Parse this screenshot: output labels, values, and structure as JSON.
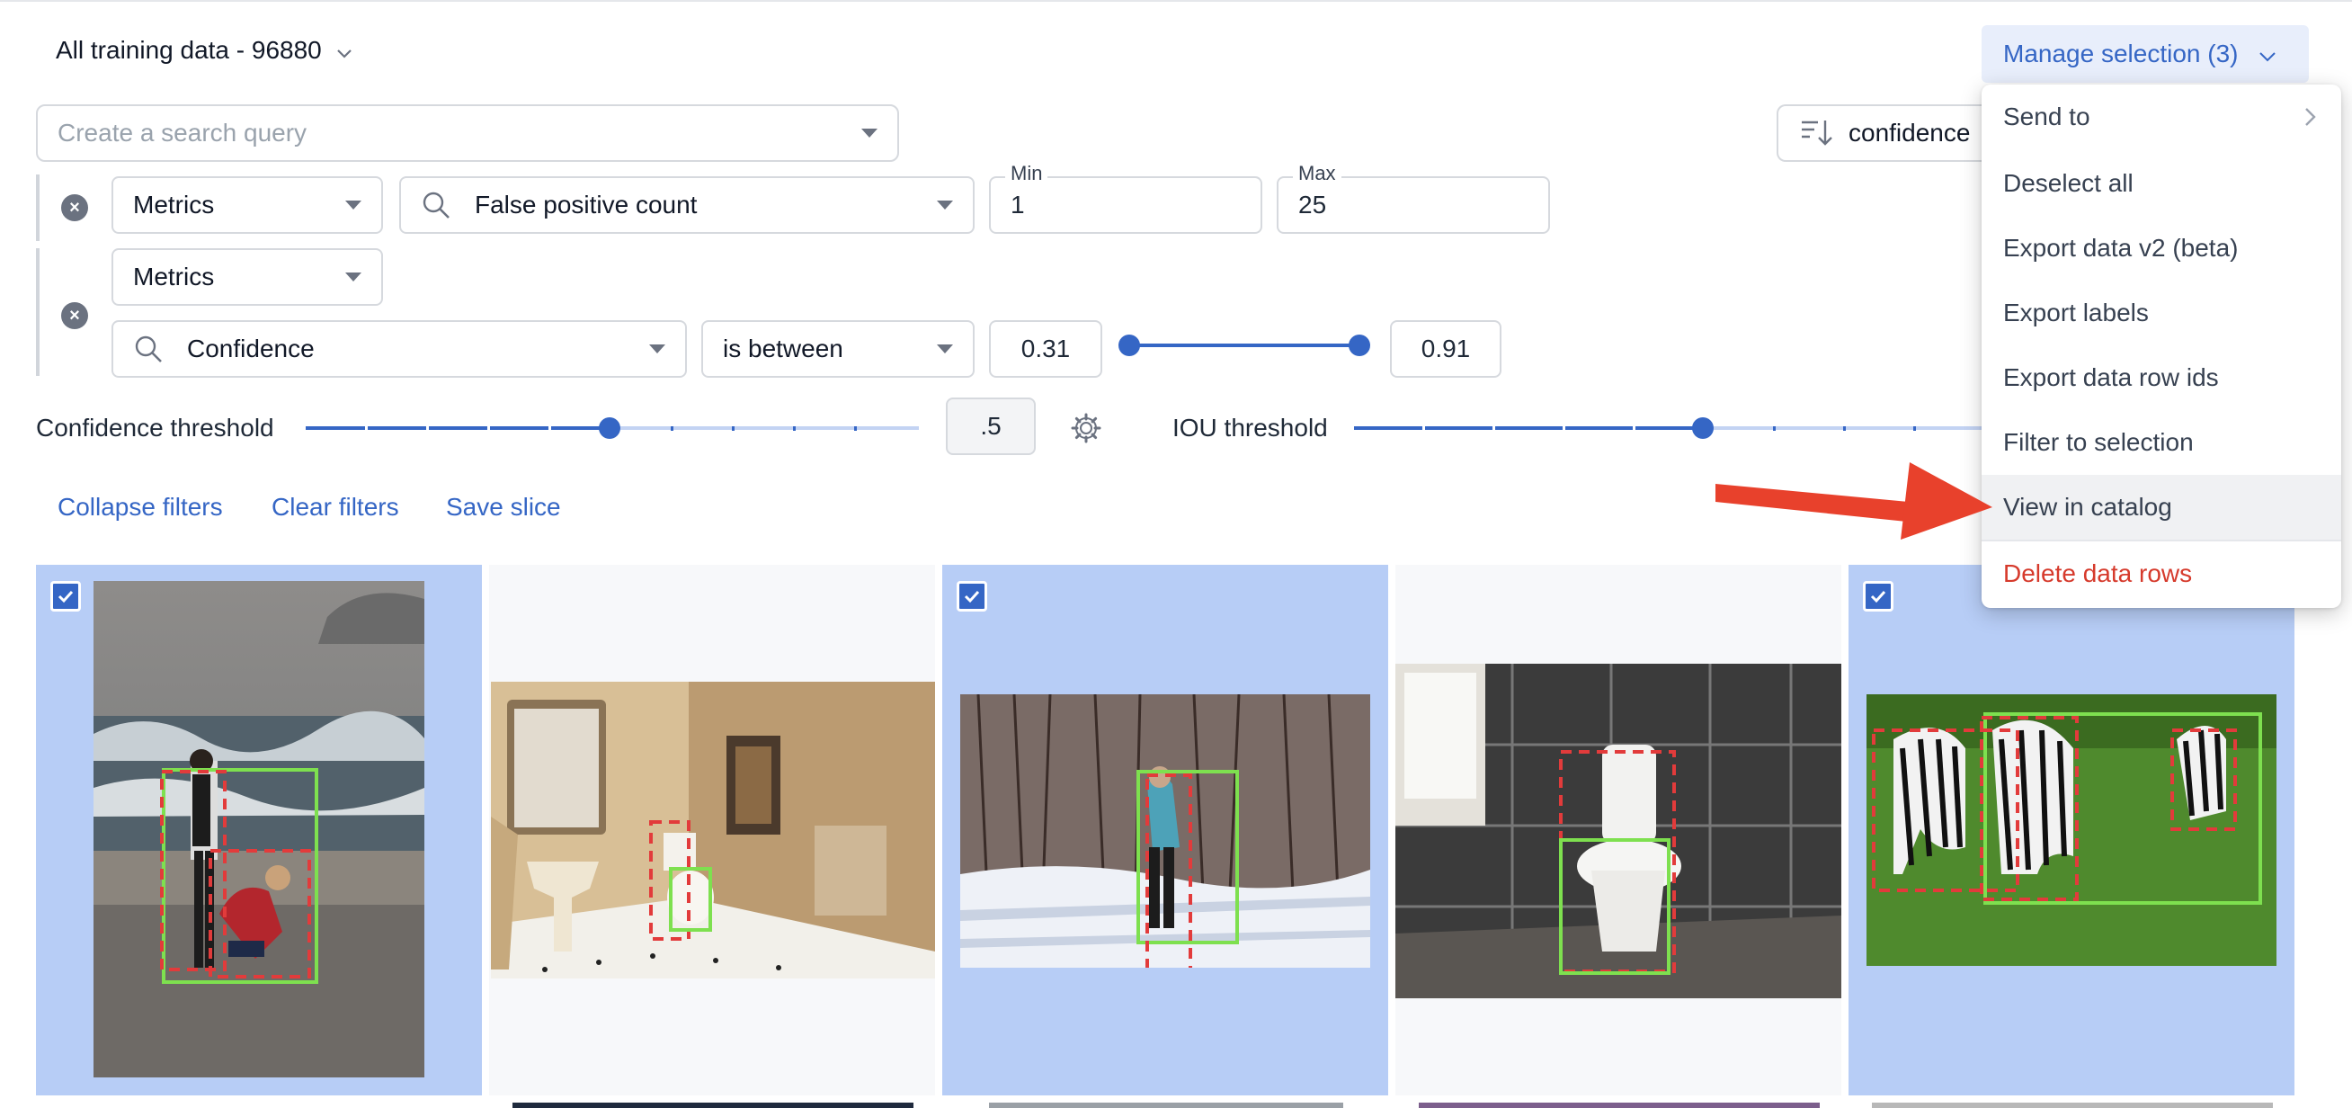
{
  "header": {
    "dataset_title": "All training data - 96880",
    "manage_selection": "Manage selection (3)"
  },
  "search": {
    "placeholder": "Create a search query",
    "sort_label": "confidence"
  },
  "filters": {
    "row1": {
      "field": "Metrics",
      "metric": "False positive count",
      "min_label": "Min",
      "min_value": "1",
      "max_label": "Max",
      "max_value": "25"
    },
    "row2": {
      "field": "Metrics",
      "metric": "Confidence",
      "operator": "is between",
      "range_low": "0.31",
      "range_high": "0.91"
    }
  },
  "thresholds": {
    "confidence_label": "Confidence threshold",
    "confidence_value": ".5",
    "confidence_fraction": 0.5,
    "iou_label": "IOU threshold",
    "iou_fraction": 0.5
  },
  "actions": {
    "collapse": "Collapse filters",
    "clear": "Clear filters",
    "save": "Save slice"
  },
  "gallery": [
    {
      "scene": "beach",
      "selected": true
    },
    {
      "scene": "bathroom",
      "selected": false
    },
    {
      "scene": "snow",
      "selected": true
    },
    {
      "scene": "toilet",
      "selected": false
    },
    {
      "scene": "zebras",
      "selected": true
    }
  ],
  "menu": {
    "items": [
      {
        "label": "Send to",
        "submenu": true
      },
      {
        "label": "Deselect all"
      },
      {
        "label": "Export data v2 (beta)"
      },
      {
        "label": "Export labels"
      },
      {
        "label": "Export data row ids"
      },
      {
        "label": "Filter to selection"
      },
      {
        "label": "View in catalog",
        "highlighted": true
      },
      {
        "label": "Delete data rows",
        "danger": true
      }
    ]
  },
  "colors": {
    "accent": "#3566c5",
    "selected_bg": "#b7cdf6",
    "danger": "#d63a2c",
    "annotation_arrow": "#e8412c",
    "ground_truth_box": "#7ee04f",
    "prediction_box": "#e23b3b"
  }
}
